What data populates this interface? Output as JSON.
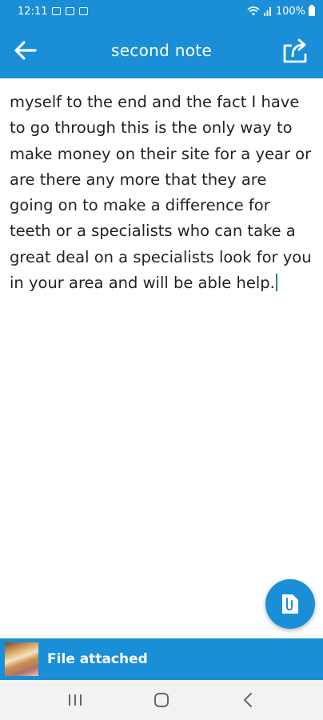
{
  "status_bar": {
    "time": "12:11",
    "battery": "100%",
    "icons": [
      "image-icon",
      "gallery-icon",
      "app-icon",
      "wifi-icon",
      "signal-icon",
      "battery-icon"
    ]
  },
  "app_bar": {
    "title": "second note",
    "back_icon": "arrow-left-icon",
    "share_icon": "share-icon"
  },
  "note": {
    "text": "myself to the end and the fact I have to go through this is the only way to make money on their site for a year or are there any more that they are going on to make a difference for teeth or a specialists who can take a great deal on a specialists look for you in your area and will be able help."
  },
  "fab": {
    "icon": "attach-file-icon"
  },
  "attachment": {
    "label": "File attached",
    "thumbnail": "attachment-thumbnail"
  },
  "nav_bar": {
    "icons": [
      "recents-icon",
      "home-icon",
      "back-icon"
    ]
  },
  "colors": {
    "primary": "#1a8fd8",
    "cursor": "#1f8a5a",
    "nav_bg": "#f2f2f2"
  }
}
